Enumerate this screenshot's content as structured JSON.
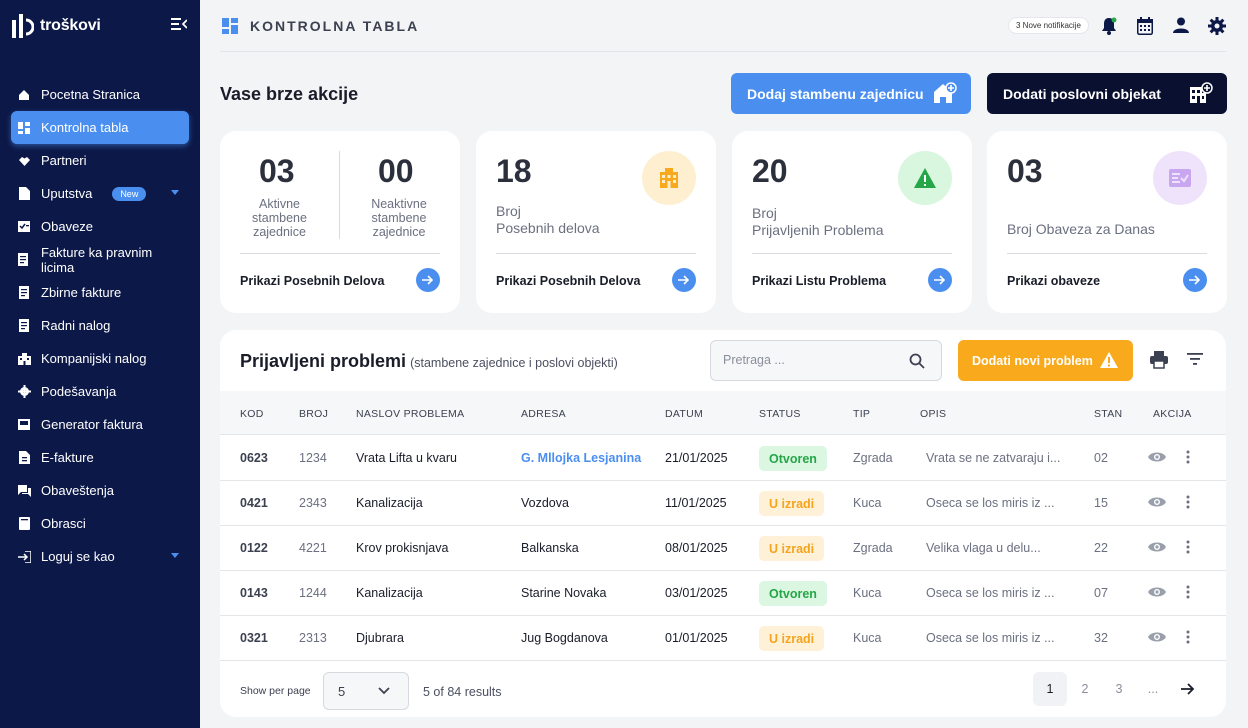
{
  "app": {
    "name": "troškovi"
  },
  "sidebar": {
    "items": [
      {
        "label": "Pocetna Stranica",
        "icon": "home-icon"
      },
      {
        "label": "Kontrolna tabla",
        "icon": "dashboard-icon",
        "active": true
      },
      {
        "label": "Partneri",
        "icon": "handshake-icon"
      },
      {
        "label": "Uputstva",
        "icon": "document-icon",
        "badge": "New"
      },
      {
        "label": "Obaveze",
        "icon": "checklist-icon"
      },
      {
        "label": "Fakture ka pravnim licima",
        "icon": "invoice-icon"
      },
      {
        "label": "Zbirne fakture",
        "icon": "invoice-icon"
      },
      {
        "label": "Radni nalog",
        "icon": "invoice-icon"
      },
      {
        "label": "Kompanijski nalog",
        "icon": "building-icon"
      },
      {
        "label": "Podešavanja",
        "icon": "gear-icon"
      },
      {
        "label": "Generator faktura",
        "icon": "generator-icon"
      },
      {
        "label": "E-fakture",
        "icon": "efile-icon"
      },
      {
        "label": "Obaveštenja",
        "icon": "chat-icon"
      },
      {
        "label": "Obrasci",
        "icon": "form-icon"
      },
      {
        "label": "Loguj se kao",
        "icon": "login-icon"
      }
    ]
  },
  "header": {
    "title": "KONTROLNA TABLA",
    "notifications": "3 Nove notifikacije"
  },
  "quick": {
    "title": "Vase brze akcije",
    "btn_add_community": "Dodaj stambenu zajednicu",
    "btn_add_business": "Dodati  poslovni objekat"
  },
  "cards": {
    "c1": {
      "active_value": "03",
      "active_label": "Aktivne\nstambene\nzajednice",
      "inactive_value": "00",
      "inactive_label": "Neaktivne\nstambene\nzajednice",
      "link": "Prikazi Posebnih Delova"
    },
    "c2": {
      "value": "18",
      "label": "Broj\nPosebnih delova",
      "link": "Prikazi Posebnih Delova"
    },
    "c3": {
      "value": "20",
      "label": "Broj\nPrijavljenih Problema",
      "link": "Prikazi Listu Problema"
    },
    "c4": {
      "value": "03",
      "label": "Broj Obaveza za Danas",
      "link": "Prikazi obaveze"
    }
  },
  "problems": {
    "title": "Prijavljeni problemi",
    "subtitle": "(stambene zajednice i poslovi objekti)",
    "search_placeholder": "Pretraga ...",
    "btn_add": "Dodati novi problem",
    "columns": [
      "KOD",
      "BROJ",
      "NASLOV PROBLEMA",
      "ADRESA",
      "DATUM",
      "STATUS",
      "TIP",
      "OPIS",
      "STAN",
      "AKCIJA"
    ],
    "rows": [
      {
        "kod": "0623",
        "broj": "1234",
        "naslov": "Vrata Lifta u kvaru",
        "adresa": "G. Mllojka Lesjanina",
        "datum": "21/01/2025",
        "status": "Otvoren",
        "tip": "Zgrada",
        "opis": "Vrata se ne zatvaraju i...",
        "stan": "02"
      },
      {
        "kod": "0421",
        "broj": "2343",
        "naslov": "Kanalizacija",
        "adresa": "Vozdova",
        "datum": "11/01/2025",
        "status": "U izradi",
        "tip": "Kuca",
        "opis": "Oseca se los miris iz ...",
        "stan": "15"
      },
      {
        "kod": "0122",
        "broj": "4221",
        "naslov": "Krov prokisnjava",
        "adresa": "Balkanska",
        "datum": "08/01/2025",
        "status": "U izradi",
        "tip": "Zgrada",
        "opis": "Velika vlaga u delu...",
        "stan": "22"
      },
      {
        "kod": "0143",
        "broj": "1244",
        "naslov": "Kanalizacija",
        "adresa": "Starine Novaka",
        "datum": "03/01/2025",
        "status": "Otvoren",
        "tip": "Kuca",
        "opis": "Oseca se los miris iz ...",
        "stan": "07"
      },
      {
        "kod": "0321",
        "broj": "2313",
        "naslov": "Djubrara",
        "adresa": "Jug Bogdanova",
        "datum": "01/01/2025",
        "status": "U izradi",
        "tip": "Kuca",
        "opis": "Oseca se los miris iz ...",
        "stan": "32"
      }
    ],
    "footer": {
      "per_page_label": "Show per page",
      "per_page_value": "5",
      "results": "5 of 84 results",
      "pages": [
        "1",
        "2",
        "3",
        "..."
      ]
    }
  },
  "colors": {
    "sidebar": "#0c1847",
    "accent": "#4a8ff0",
    "warning": "#f9a91c",
    "open": "#25a648"
  }
}
